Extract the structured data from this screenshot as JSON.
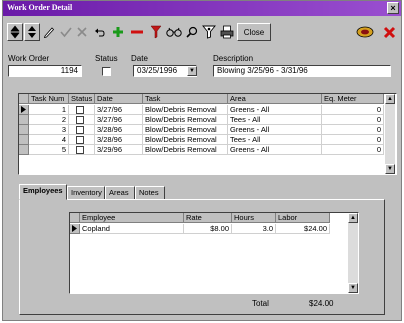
{
  "window": {
    "title": "Work Order Detail",
    "close_glyph": "×"
  },
  "toolbar": {
    "icons": [
      "first-record-icon",
      "last-record-icon",
      "edit-pencil-icon",
      "save-check-icon",
      "cancel-x-icon",
      "undo-arrow-icon",
      "add-plus-icon",
      "delete-minus-icon",
      "filter-funnel-icon",
      "find-binoculars-icon",
      "search-magnifier-icon",
      "query-icon",
      "print-icon"
    ],
    "close_label": "Close",
    "right_icons": [
      "exit-door-icon",
      "cancel-red-x-icon"
    ]
  },
  "form": {
    "work_order_label": "Work Order",
    "work_order_value": "1194",
    "status_label": "Status",
    "date_label": "Date",
    "date_value": "03/25/1996",
    "description_label": "Description",
    "description_value": "Blowing 3/25/96 - 3/31/96"
  },
  "tasks": {
    "columns": [
      "Task Num",
      "Status",
      "Date",
      "Task",
      "Area",
      "Eq. Meter"
    ],
    "rows": [
      {
        "num": "1",
        "date": "3/27/96",
        "task": "Blow/Debris Removal",
        "area": "Greens - All",
        "meter": "0"
      },
      {
        "num": "2",
        "date": "3/27/96",
        "task": "Blow/Debris Removal",
        "area": "Tees - All",
        "meter": "0"
      },
      {
        "num": "3",
        "date": "3/28/96",
        "task": "Blow/Debris Removal",
        "area": "Greens - All",
        "meter": "0"
      },
      {
        "num": "4",
        "date": "3/28/96",
        "task": "Blow/Debris Removal",
        "area": "Tees - All",
        "meter": "0"
      },
      {
        "num": "5",
        "date": "3/29/96",
        "task": "Blow/Debris Removal",
        "area": "Greens - All",
        "meter": "0"
      }
    ]
  },
  "tabs": [
    "Employees",
    "Inventory",
    "Areas",
    "Notes"
  ],
  "active_tab": "Employees",
  "employees": {
    "columns": [
      "Employee",
      "Rate",
      "Hours",
      "Labor"
    ],
    "rows": [
      {
        "employee": "Copland",
        "rate": "$8.00",
        "hours": "3.0",
        "labor": "$24.00"
      }
    ],
    "total_label": "Total",
    "total_value": "$24.00"
  }
}
